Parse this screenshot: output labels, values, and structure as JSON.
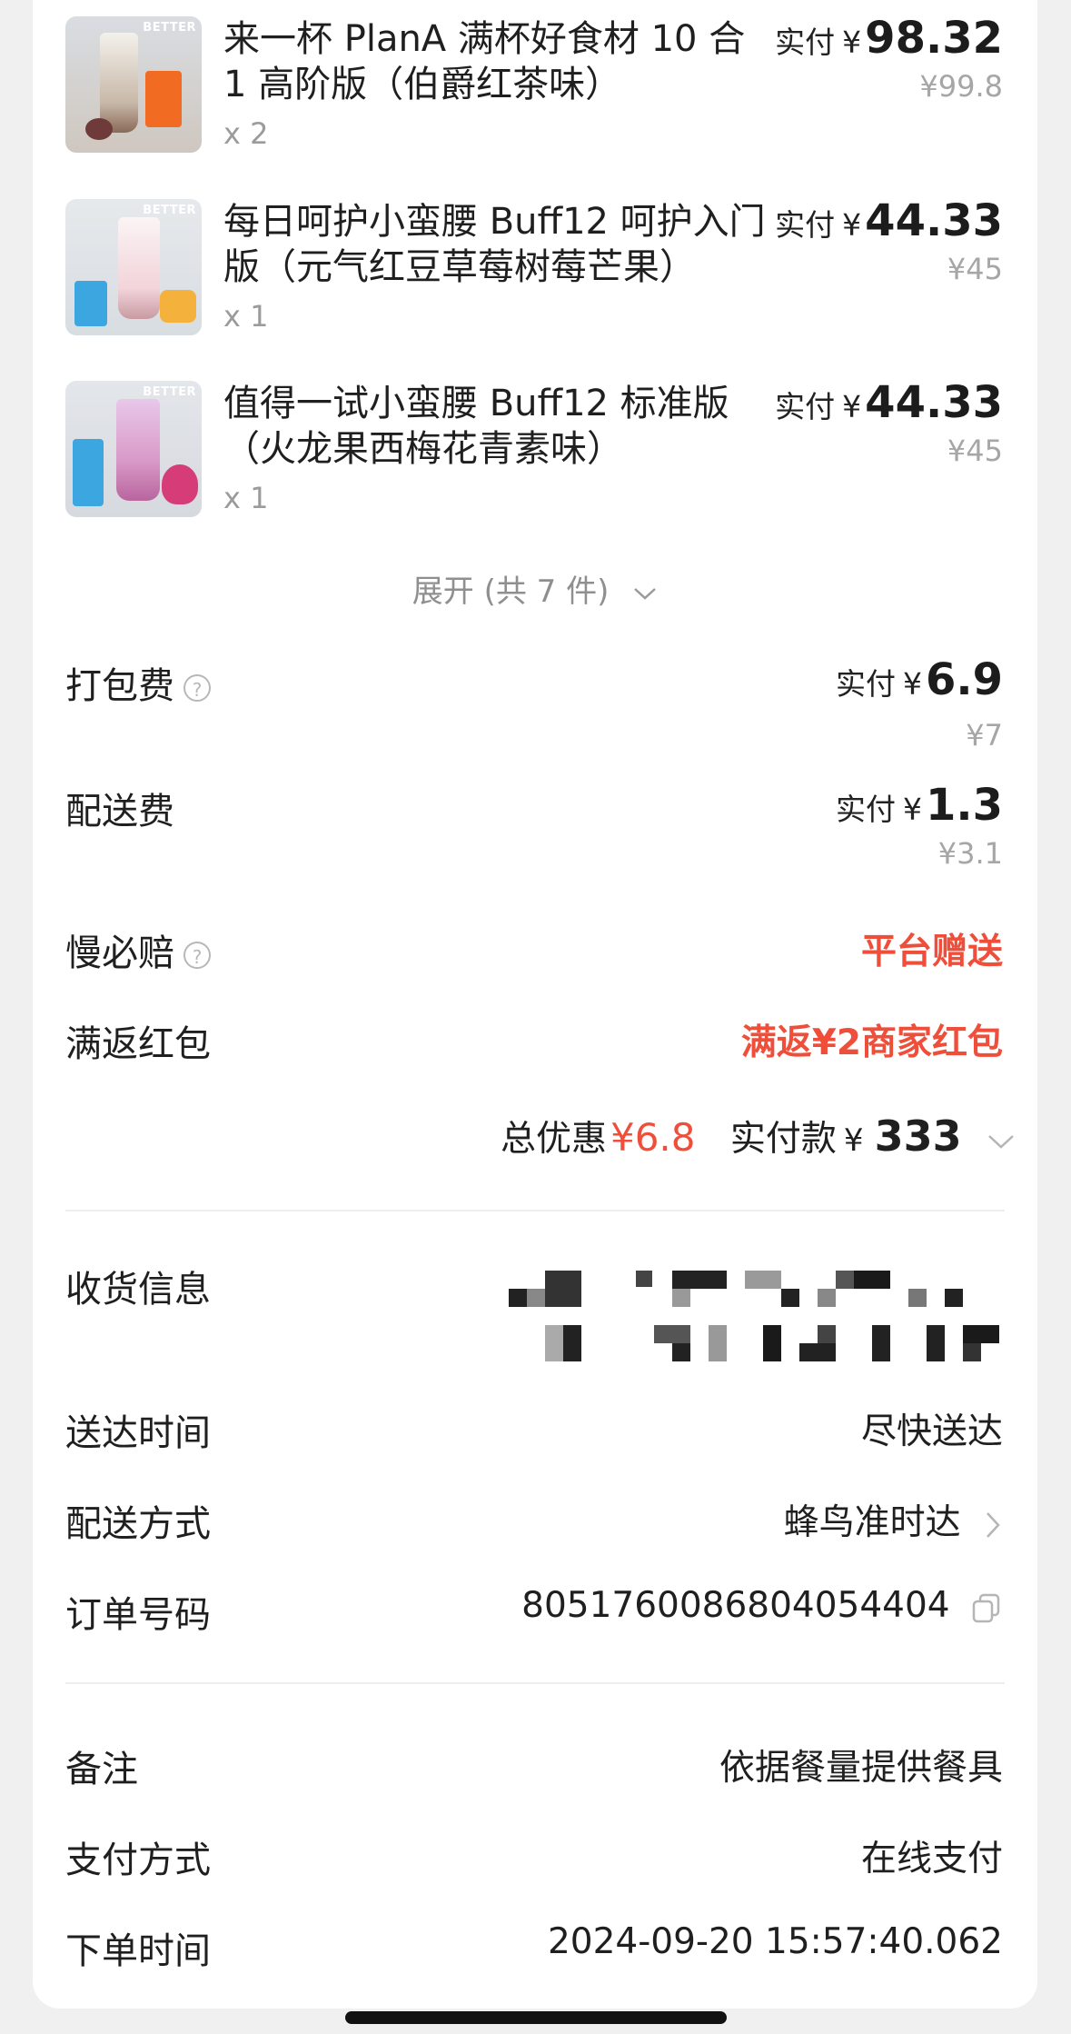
{
  "products": [
    {
      "name": "来一杯 PlanA 满杯好食材 10 合 1 高阶版（伯爵红茶味）",
      "qty": "x 2",
      "paid_label": "实付",
      "currency": "¥",
      "paid": "98.32",
      "original": "¥99.8"
    },
    {
      "name": "每日呵护小蛮腰 Buff12 呵护入门版（元气红豆草莓树莓芒果）",
      "qty": "x 1",
      "paid_label": "实付",
      "currency": "¥",
      "paid": "44.33",
      "original": "¥45"
    },
    {
      "name": "值得一试小蛮腰 Buff12 标准版（火龙果西梅花青素味）",
      "qty": "x 1",
      "paid_label": "实付",
      "currency": "¥",
      "paid": "44.33",
      "original": "¥45"
    }
  ],
  "product_image_brand": "BETTER",
  "expand_label": "展开 (共 7 件)",
  "fees": {
    "packing": {
      "label": "打包费",
      "paid_label": "实付",
      "currency": "¥",
      "paid": "6.9",
      "original": "¥7"
    },
    "delivery": {
      "label": "配送费",
      "paid_label": "实付",
      "currency": "¥",
      "paid": "1.3",
      "original": "¥3.1"
    },
    "late_comp": {
      "label": "慢必赔",
      "value": "平台赠送"
    },
    "red_packet": {
      "label": "满返红包",
      "value": "满返¥2商家红包"
    }
  },
  "totals": {
    "discount_label": "总优惠",
    "discount_value": "¥6.8",
    "paid_label": "实付款",
    "paid_currency": "¥",
    "paid_value": "333"
  },
  "info": {
    "address_label": "收货信息",
    "time_label": "送达时间",
    "time_value": "尽快送达",
    "method_label": "配送方式",
    "method_value": "蜂鸟准时达",
    "order_label": "订单号码",
    "order_value": "8051760086804054404",
    "note_label": "备注",
    "note_value": "依据餐量提供餐具",
    "pay_label": "支付方式",
    "pay_value": "在线支付",
    "placed_label": "下单时间",
    "placed_value": "2024-09-20 15:57:40.062"
  },
  "colors": {
    "accent_red": "#ef4f3a",
    "text": "#1f1f1f",
    "muted": "#a6a6a6"
  },
  "icons": [
    "help-circle-icon",
    "chevron-down-icon",
    "chevron-right-icon",
    "copy-icon"
  ]
}
